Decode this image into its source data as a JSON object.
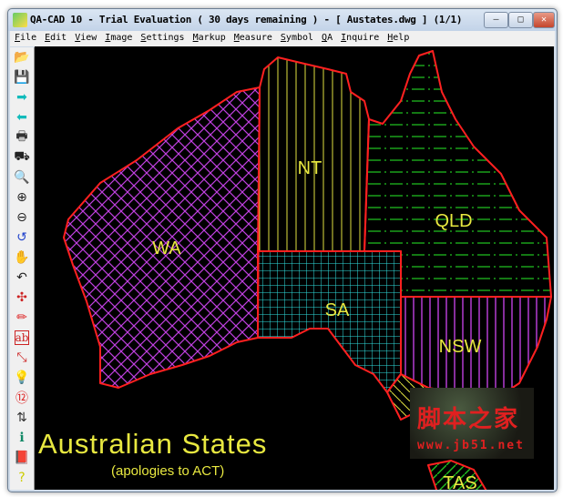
{
  "window": {
    "title": "QA-CAD 10 - Trial Evaluation ( 30 days remaining )  -  [ Austates.dwg ] (1/1)",
    "minimize": "–",
    "maximize": "□",
    "close": "✕"
  },
  "menu": [
    "File",
    "Edit",
    "View",
    "Image",
    "Settings",
    "Markup",
    "Measure",
    "Symbol",
    "QA",
    "Inquire",
    "Help"
  ],
  "toolbar": [
    {
      "name": "open-icon",
      "glyph": "📂",
      "color": "#c9a23a"
    },
    {
      "name": "save-icon",
      "glyph": "💾",
      "color": "#224"
    },
    {
      "name": "forward-arrow-icon",
      "glyph": "➡",
      "color": "#1bb"
    },
    {
      "name": "back-arrow-icon",
      "glyph": "⬅",
      "color": "#1bb"
    },
    {
      "name": "print-icon",
      "glyph": "🖶",
      "color": "#333"
    },
    {
      "name": "binoculars-icon",
      "glyph": "⛟",
      "color": "#222"
    },
    {
      "name": "zoom-icon",
      "glyph": "🔍",
      "color": "#222"
    },
    {
      "name": "zoom-in-icon",
      "glyph": "⊕",
      "color": "#222"
    },
    {
      "name": "zoom-out-icon",
      "glyph": "⊖",
      "color": "#222"
    },
    {
      "name": "zoom-previous-icon",
      "glyph": "↺",
      "color": "#24c"
    },
    {
      "name": "pan-hand-icon",
      "glyph": "✋",
      "color": "#555"
    },
    {
      "name": "undo-arrow-icon",
      "glyph": "↶",
      "color": "#222"
    },
    {
      "name": "markup-tool-icon",
      "glyph": "✣",
      "color": "#c22"
    },
    {
      "name": "pencil-icon",
      "glyph": "✏",
      "color": "#d22"
    },
    {
      "name": "text-ab-icon",
      "glyph": "ab",
      "color": "#c22"
    },
    {
      "name": "dimension-icon",
      "glyph": "⤡",
      "color": "#c22"
    },
    {
      "name": "bulb-icon",
      "glyph": "💡",
      "color": "#cc8"
    },
    {
      "name": "balloon-number-icon",
      "glyph": "⑫",
      "color": "#d22"
    },
    {
      "name": "layers-icon",
      "glyph": "⇅",
      "color": "#333"
    },
    {
      "name": "info-icon",
      "glyph": "ℹ",
      "color": "#186"
    },
    {
      "name": "book-icon",
      "glyph": "📕",
      "color": "#a3a"
    },
    {
      "name": "help-icon",
      "glyph": "?",
      "color": "#cc0"
    }
  ],
  "drawing": {
    "states": [
      "WA",
      "NT",
      "QLD",
      "SA",
      "NSW",
      "TAS"
    ],
    "title": "Australian States",
    "subtitle": "(apologies to ACT)"
  },
  "watermark": {
    "text": "脚本之家",
    "url": "www.jb51.net"
  }
}
